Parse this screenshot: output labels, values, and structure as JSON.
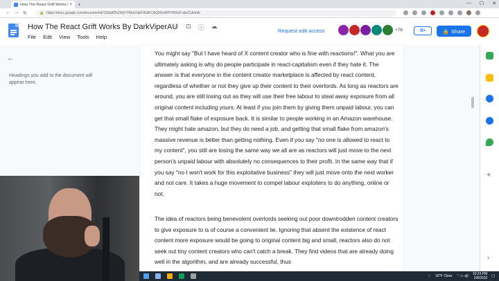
{
  "browser": {
    "tab_title": "How The React Grift Works By Da",
    "tab_close": "×",
    "new_tab": "+",
    "url": "https://docs.google.com/document/d/1S0q9DhZWjYYRbd7aEFIGiiFCAQD5s9KfYH0GD-qInZ1A/edit",
    "back": "←",
    "forward": "→",
    "reload": "↻",
    "min": "—",
    "max": "☐",
    "close": "✕"
  },
  "doc": {
    "title": "How The React Grift Works By DarkViperAU",
    "menus": [
      "File",
      "Edit",
      "View",
      "Tools",
      "Help"
    ],
    "request_edit": "Request edit access",
    "more_viewers": "+76",
    "share_label": "Share"
  },
  "outline": {
    "back_arrow": "←",
    "hint": "Headings you add to the document will appear here."
  },
  "content": {
    "paragraph1": "You might say \"But I have heard of X content creator who is fine with reactions!\". What you are ultimately asking is why do people participate in react-capitalism even if they hate it. The answer is that everyone in the content creator marketplace is affected by react content, regardless of whether or not they give up their content to their overlords. As long as reactors are around, you are still losing out as they will use their free labour to steal away exposure from all original content including yours. At least if you join them by giving them unpaid labour, you can get that small flake of exposure back. It is similar to people working in an Amazon warehouse. They might hate amazon, but they do need a job, and getting that small flake from amazon's massive revenue is better than getting nothing. Even if you say \"no one is allowed to react to my content\", you still are losing the same way we all are as reactors will just move to the next person's unpaid labour with absolutely no consequences to their profit. In the same way that if you say \"no I won't work for this exploitative business\" they will just move onto the next worker and not care. It takes a huge movement to compel labour exploiters to do anything, online or not.",
    "paragraph2": "The idea of reactors being benevolent overlords seeking out poor downtrodden content creators to give exposure to is of course a convenient lie. Ignoring that absent the existence of react content more exposure would be going to original content big and small, reactors also do not seek out tiny content creators who can't catch a break. They find videos that are already doing well in the algorithm, and are already successful, thus"
  },
  "taskbar": {
    "weather": "32°F Clear",
    "time": "10:23 PM",
    "date": "2/8/2022"
  },
  "colors": {
    "accent": "#1a73e8",
    "docs_blue": "#4285f4"
  }
}
